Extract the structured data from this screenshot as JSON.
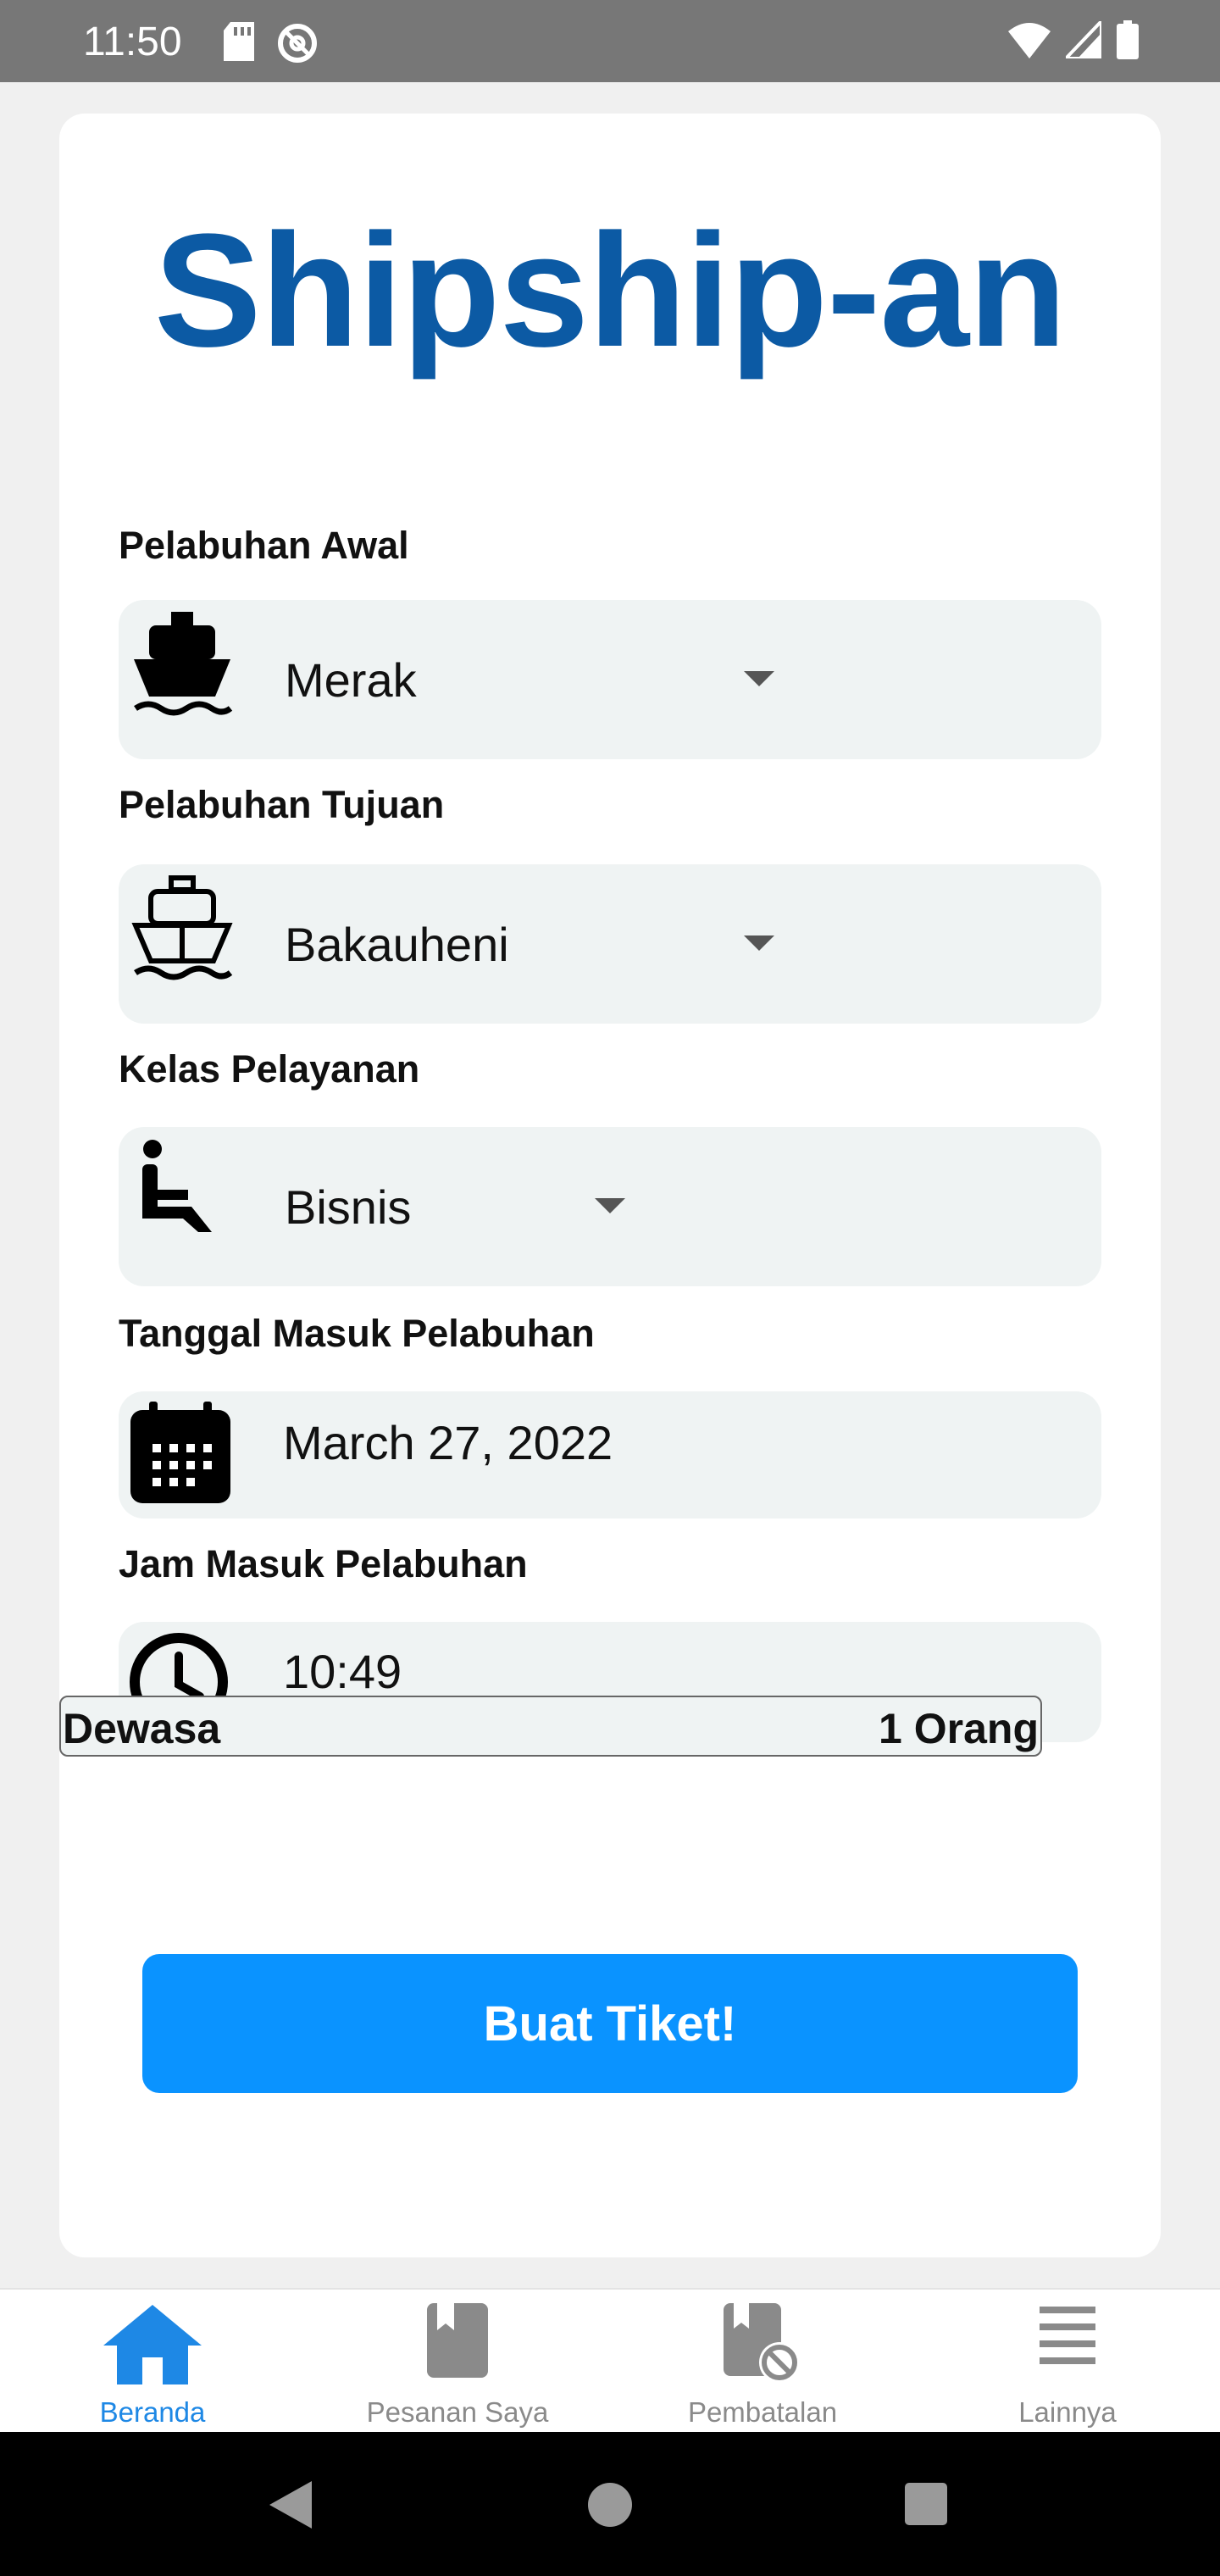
{
  "status_bar": {
    "time": "11:50",
    "left_icons": [
      "sd-card-icon",
      "at-sign-icon"
    ],
    "right_icons": [
      "wifi-icon",
      "signal-icon",
      "battery-icon"
    ]
  },
  "app": {
    "title": "Shipship-an"
  },
  "form": {
    "origin": {
      "label": "Pelabuhan Awal",
      "value": "Merak",
      "icon": "ship-filled-icon"
    },
    "destination": {
      "label": "Pelabuhan Tujuan",
      "value": "Bakauheni",
      "icon": "ship-outline-icon"
    },
    "service_class": {
      "label": "Kelas Pelayanan",
      "value": "Bisnis",
      "icon": "seat-icon"
    },
    "date": {
      "label": "Tanggal Masuk Pelabuhan",
      "value": "March 27, 2022",
      "icon": "calendar-icon"
    },
    "time": {
      "label": "Jam Masuk Pelabuhan",
      "value": "10:49",
      "icon": "clock-icon"
    },
    "passengers": {
      "label": "Dewasa",
      "count": "1 Orang"
    },
    "submit_label": "Buat Tiket!"
  },
  "bottom_nav": {
    "items": [
      {
        "label": "Beranda",
        "icon": "home-icon",
        "active": true
      },
      {
        "label": "Pesanan Saya",
        "icon": "bookmark-book-icon",
        "active": false
      },
      {
        "label": "Pembatalan",
        "icon": "cancel-booking-icon",
        "active": false
      },
      {
        "label": "Lainnya",
        "icon": "menu-icon",
        "active": false
      }
    ]
  },
  "colors": {
    "brand": "#0c5aa4",
    "button": "#0a93ff",
    "field_bg": "#eff3f3",
    "nav_active": "#1e88e5",
    "nav_inactive": "#8a8a8a"
  }
}
